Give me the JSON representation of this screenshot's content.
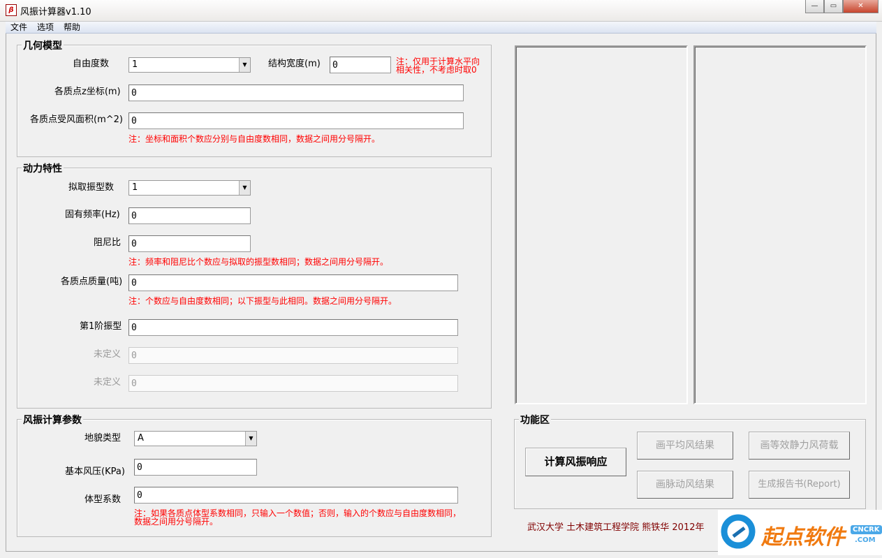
{
  "window": {
    "title": "风振计算器v1.10",
    "icon_text": "β",
    "controls": [
      "minimize",
      "maximize",
      "close"
    ]
  },
  "menu": [
    "文件",
    "选项",
    "帮助"
  ],
  "geometry": {
    "title": "几何模型",
    "dof_label": "自由度数",
    "dof_value": "1",
    "width_label": "结构宽度(m)",
    "width_value": "0",
    "width_note_1": "注：仅用于计算水平向",
    "width_note_2": "相关性，不考虑时取0",
    "z_label": "各质点z坐标(m)",
    "z_value": "0",
    "area_label": "各质点受风面积(m^2)",
    "area_value": "0",
    "note": "注：坐标和面积个数应分别与自由度数相同，数据之间用分号隔开。"
  },
  "dynamics": {
    "title": "动力特性",
    "modes_label": "拟取振型数",
    "modes_value": "1",
    "freq_label": "固有频率(Hz)",
    "freq_value": "0",
    "damp_label": "阻尼比",
    "damp_value": "0",
    "note1": "注：频率和阻尼比个数应与拟取的振型数相同；数据之间用分号隔开。",
    "mass_label": "各质点质量(吨)",
    "mass_value": "0",
    "note2": "注：个数应与自由度数相同；以下振型与此相同。数据之间用分号隔开。",
    "mode1_label": "第1阶振型",
    "mode1_value": "0",
    "undef_label": "未定义",
    "undef2_value": "0",
    "undef3_value": "0"
  },
  "wind": {
    "title": "风振计算参数",
    "terrain_label": "地貌类型",
    "terrain_value": "A",
    "pressure_label": "基本风压(KPa)",
    "pressure_value": "0",
    "shape_label": "体型系数",
    "shape_value": "0",
    "note_1": "注：如果各质点体型系数相同，只输入一个数值；否则，输入的个数应与自由度数相同，",
    "note_2": "数据之间用分号隔开。"
  },
  "functions": {
    "title": "功能区",
    "calc": "计算风振响应",
    "mean": "画平均风结果",
    "static": "画等效静力风荷载",
    "fluct": "画脉动风结果",
    "report": "生成报告书(Report)"
  },
  "footer": "武汉大学 土木建筑工程学院 熊铁华 2012年",
  "watermark": {
    "text": "起点软件",
    "badge": "CNCRK",
    "domain": ".COM"
  },
  "colors": {
    "note": "#ff0000",
    "footer": "#800000",
    "accent": "#1a8fd8",
    "logo": "#f07a10"
  }
}
